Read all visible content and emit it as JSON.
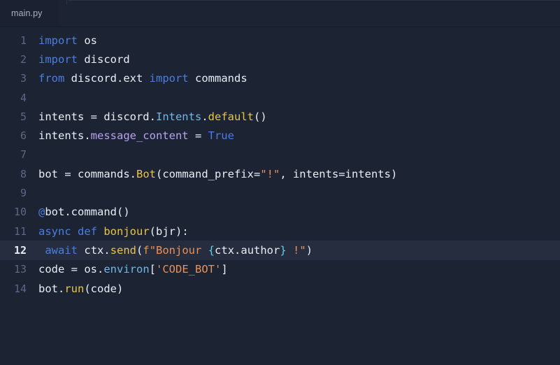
{
  "window": {
    "background_color": "#1c2333",
    "editor_background_color": "#1c2333",
    "active_line_color": "#262d3e"
  },
  "tabbar": {
    "tabs": [
      {
        "label": "main.py",
        "active": true
      }
    ]
  },
  "editor": {
    "active_line": 12,
    "total_lines": 14,
    "lines": [
      {
        "number": "1",
        "text": "import os"
      },
      {
        "number": "2",
        "text": "import discord"
      },
      {
        "number": "3",
        "text": "from discord.ext import commands"
      },
      {
        "number": "4",
        "text": ""
      },
      {
        "number": "5",
        "text": "intents = discord.Intents.default()"
      },
      {
        "number": "6",
        "text": "intents.message_content = True"
      },
      {
        "number": "7",
        "text": ""
      },
      {
        "number": "8",
        "text": "bot = commands.Bot(command_prefix=\"!\", intents=intents)"
      },
      {
        "number": "9",
        "text": ""
      },
      {
        "number": "10",
        "text": "@bot.command()"
      },
      {
        "number": "11",
        "text": "async def bonjour(bjr):"
      },
      {
        "number": "12",
        "text": " await ctx.send(f\"Bonjour {ctx.author} !\")"
      },
      {
        "number": "13",
        "text": "code = os.environ['CODE_BOT']"
      },
      {
        "number": "14",
        "text": "bot.run(code)"
      }
    ],
    "syntax_colors": {
      "keyword": "#4a7ee0",
      "function": "#e8c547",
      "class": "#6fb8e8",
      "attribute": "#b9a2f0",
      "string": "#e8915a",
      "fstring_brace": "#5fd3e0",
      "plain": "#e9edf5",
      "line_number": "#5c6886",
      "line_number_active": "#e6ebf5"
    }
  }
}
